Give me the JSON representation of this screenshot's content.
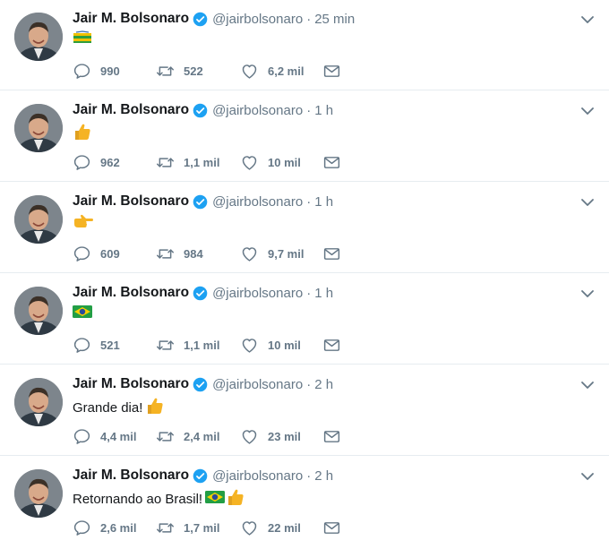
{
  "tweets": [
    {
      "name": "Jair M. Bolsonaro",
      "handle": "@jairbolsonaro",
      "sep": "·",
      "time": "25 min",
      "text": "",
      "emoji": "flag-strip",
      "replies": "990",
      "retweets": "522",
      "likes": "6,2 mil"
    },
    {
      "name": "Jair M. Bolsonaro",
      "handle": "@jairbolsonaro",
      "sep": "·",
      "time": "1 h",
      "text": "",
      "emoji": "thumbs-up",
      "replies": "962",
      "retweets": "1,1 mil",
      "likes": "10 mil"
    },
    {
      "name": "Jair M. Bolsonaro",
      "handle": "@jairbolsonaro",
      "sep": "·",
      "time": "1 h",
      "text": "",
      "emoji": "pointing-right",
      "replies": "609",
      "retweets": "984",
      "likes": "9,7 mil"
    },
    {
      "name": "Jair M. Bolsonaro",
      "handle": "@jairbolsonaro",
      "sep": "·",
      "time": "1 h",
      "text": "",
      "emoji": "brazil-flag",
      "replies": "521",
      "retweets": "1,1 mil",
      "likes": "10 mil"
    },
    {
      "name": "Jair M. Bolsonaro",
      "handle": "@jairbolsonaro",
      "sep": "·",
      "time": "2 h",
      "text": "Grande dia!",
      "emoji": "thumbs-up",
      "replies": "4,4 mil",
      "retweets": "2,4 mil",
      "likes": "23 mil"
    },
    {
      "name": "Jair M. Bolsonaro",
      "handle": "@jairbolsonaro",
      "sep": "·",
      "time": "2 h",
      "text": "Retornando ao Brasil!",
      "emoji": "brazil-flag+thumbs-up",
      "replies": "2,6 mil",
      "retweets": "1,7 mil",
      "likes": "22 mil"
    }
  ],
  "colors": {
    "verified": "#1da1f2",
    "icon": "#657786",
    "border": "#e6ecf0",
    "text": "#14171a",
    "thumb": "#f5b324"
  }
}
